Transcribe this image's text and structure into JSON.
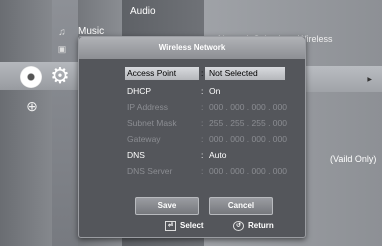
{
  "background_menu": {
    "left_items": [
      "Music"
    ],
    "column3_items": [
      "Audio"
    ],
    "column4_top": "Network Selection : Wireless",
    "column4_note": "(Vaild Only)"
  },
  "popup": {
    "title": "Wireless Network",
    "rows": [
      {
        "label": "Access Point",
        "value": "Not Selected",
        "selected": true
      },
      {
        "label": "DHCP",
        "value": "On"
      },
      {
        "label": "IP Address",
        "value": "000 . 000 . 000 . 000"
      },
      {
        "label": "Subnet Mask",
        "value": "255 . 255 . 255 . 000"
      },
      {
        "label": "Gateway",
        "value": "000 . 000 . 000 . 000"
      },
      {
        "label": "DNS",
        "value": "Auto"
      },
      {
        "label": "DNS Server",
        "value": "000 . 000 . 000 . 000"
      }
    ],
    "colon": ":",
    "save_label": "Save",
    "cancel_label": "Cancel",
    "footer": {
      "select_label": "Select",
      "return_label": "Return"
    }
  },
  "colors": {
    "popup_bg": "#54565b",
    "highlight": "#d8dade",
    "dim_text": "#8b8d92"
  }
}
